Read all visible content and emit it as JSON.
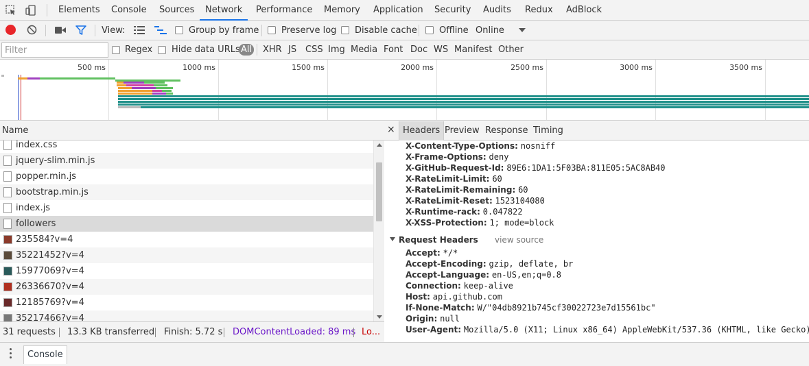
{
  "tabs": [
    "Elements",
    "Console",
    "Sources",
    "Network",
    "Performance",
    "Memory",
    "Application",
    "Security",
    "Audits",
    "Redux",
    "AdBlock"
  ],
  "active_tab": "Network",
  "toolbar": {
    "view_label": "View:",
    "group_by_frame": "Group by frame",
    "preserve_log": "Preserve log",
    "disable_cache": "Disable cache",
    "offline": "Offline",
    "throttling": "Online"
  },
  "filter": {
    "placeholder": "Filter",
    "regex": "Regex",
    "hide_data_urls": "Hide data URLs",
    "types": [
      "All",
      "XHR",
      "JS",
      "CSS",
      "Img",
      "Media",
      "Font",
      "Doc",
      "WS",
      "Manifest",
      "Other"
    ],
    "selected_type": "All"
  },
  "timeline": {
    "ticks": [
      "500 ms",
      "1000 ms",
      "1500 ms",
      "2000 ms",
      "2500 ms",
      "3000 ms",
      "3500 ms"
    ]
  },
  "list": {
    "header": "Name",
    "rows": [
      {
        "name": "index.css",
        "kind": "doc"
      },
      {
        "name": "jquery-slim.min.js",
        "kind": "doc"
      },
      {
        "name": "popper.min.js",
        "kind": "doc"
      },
      {
        "name": "bootstrap.min.js",
        "kind": "doc"
      },
      {
        "name": "index.js",
        "kind": "doc"
      },
      {
        "name": "followers",
        "kind": "doc",
        "selected": true
      },
      {
        "name": "235584?v=4",
        "kind": "img",
        "color": "#8b3a2a"
      },
      {
        "name": "35221452?v=4",
        "kind": "img",
        "color": "#5a4a3a"
      },
      {
        "name": "15977069?v=4",
        "kind": "img",
        "color": "#2a5a5a"
      },
      {
        "name": "26336670?v=4",
        "kind": "img",
        "color": "#b03020"
      },
      {
        "name": "12185769?v=4",
        "kind": "img",
        "color": "#6a2a2a"
      },
      {
        "name": "35217466?v=4",
        "kind": "img",
        "color": "#777777"
      }
    ]
  },
  "status": {
    "requests": "31 requests",
    "transferred": "13.3 KB transferred",
    "finish": "Finish: 5.72 s",
    "dcl": "DOMContentLoaded: 89 ms",
    "load": "Lo..."
  },
  "details": {
    "close": "×",
    "tabs": [
      "Headers",
      "Preview",
      "Response",
      "Timing"
    ],
    "active_tab": "Headers",
    "response_headers": [
      {
        "key": "X-Content-Type-Options:",
        "value": "nosniff"
      },
      {
        "key": "X-Frame-Options:",
        "value": "deny"
      },
      {
        "key": "X-GitHub-Request-Id:",
        "value": "89E6:1DA1:5F03BA:811E05:5AC8AB40"
      },
      {
        "key": "X-RateLimit-Limit:",
        "value": "60"
      },
      {
        "key": "X-RateLimit-Remaining:",
        "value": "60"
      },
      {
        "key": "X-RateLimit-Reset:",
        "value": "1523104080"
      },
      {
        "key": "X-Runtime-rack:",
        "value": "0.047822"
      },
      {
        "key": "X-XSS-Protection:",
        "value": "1; mode=block"
      }
    ],
    "request_section_title": "Request Headers",
    "view_source": "view source",
    "request_headers": [
      {
        "key": "Accept:",
        "value": "*/*"
      },
      {
        "key": "Accept-Encoding:",
        "value": "gzip, deflate, br"
      },
      {
        "key": "Accept-Language:",
        "value": "en-US,en;q=0.8"
      },
      {
        "key": "Connection:",
        "value": "keep-alive"
      },
      {
        "key": "Host:",
        "value": "api.github.com"
      },
      {
        "key": "If-None-Match:",
        "value": "W/\"04db8921b745cf30022723e7d15561bc\""
      },
      {
        "key": "Origin:",
        "value": "null"
      },
      {
        "key": "User-Agent:",
        "value": "Mozilla/5.0 (X11; Linux x86_64) AppleWebKit/537.36 (KHTML, like Gecko)"
      }
    ]
  },
  "drawer": {
    "tab": "Console"
  },
  "colors": {
    "active_tab_underline": "#1a73e8",
    "record": "#e8262a",
    "filter_active": "#1a73e8",
    "dcl": "#6b18c8",
    "load": "#c80000"
  }
}
